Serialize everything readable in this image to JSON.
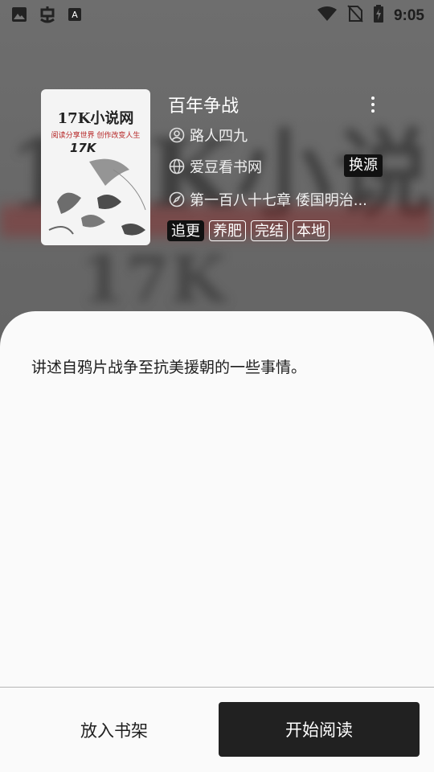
{
  "status_bar": {
    "time": "9:05",
    "left_icons": [
      "image-icon",
      "bug-icon",
      "font-icon"
    ],
    "right_icons": [
      "wifi-icon",
      "no-sim-icon",
      "battery-charging-icon"
    ]
  },
  "cover": {
    "title": "17K小说网",
    "subtitle": "阅读分享世界 创作改变人生",
    "logo": "17K"
  },
  "book": {
    "title": "百年争战",
    "author": "路人四九",
    "source": "爱豆看书网",
    "switch_source_label": "换源",
    "latest_chapter": "第一百八十七章 倭国明治...",
    "tags": [
      {
        "label": "追更",
        "filled": true
      },
      {
        "label": "养肥",
        "filled": false
      },
      {
        "label": "完结",
        "filled": false
      },
      {
        "label": "本地",
        "filled": false
      }
    ]
  },
  "intro": "讲述自鸦片战争至抗美援朝的一些事情。",
  "actions": {
    "add_to_shelf": "放入书架",
    "start_reading": "开始阅读"
  },
  "colors": {
    "header_bg": "#6b6b6b",
    "sheet_bg": "#fafafa",
    "primary_button": "#212121"
  }
}
